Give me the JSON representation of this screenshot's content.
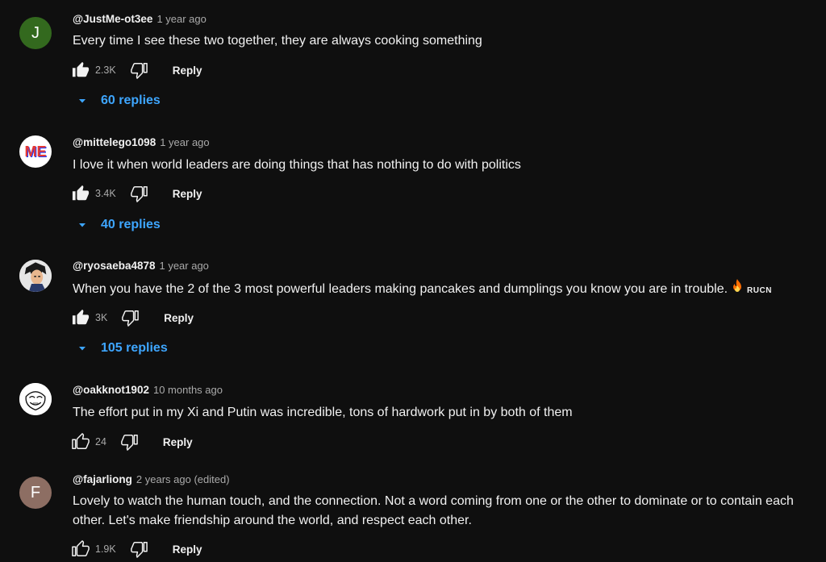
{
  "comments": [
    {
      "handle": "@JustMe-ot3ee",
      "time": "1 year ago",
      "avatar_letter": "J",
      "avatar_color": "#33691e",
      "text": "Every time I see these two together, they are always cooking something",
      "likes": "2.3K",
      "reply_label": "Reply",
      "replies_label": "60 replies"
    },
    {
      "handle": "@mittelego1098",
      "time": "1 year ago",
      "avatar_letter": "ME",
      "text": "I love it when world leaders are doing things that has nothing to do with politics",
      "likes": "3.4K",
      "reply_label": "Reply",
      "replies_label": "40 replies"
    },
    {
      "handle": "@ryosaeba4878",
      "time": "1 year ago",
      "text": "When you have the 2 of the 3 most powerful leaders making pancakes and dumplings you know you are in trouble.",
      "emoji": "fire-emoji",
      "badge": "RUCN",
      "likes": "3K",
      "reply_label": "Reply",
      "replies_label": "105 replies"
    },
    {
      "handle": "@oakknot1902",
      "time": "10 months ago",
      "text": "The effort put in my Xi and Putin was incredible, tons of hardwork put in by both of them",
      "likes": "24",
      "reply_label": "Reply"
    },
    {
      "handle": "@fajarliong",
      "time": "2 years ago (edited)",
      "avatar_letter": "F",
      "avatar_color": "#8d6e63",
      "text": "Lovely to watch the human touch, and the connection. Not a word coming from one or the other to dominate or to contain each other. Let's make friendship around the world, and respect each other.",
      "likes": "1.9K",
      "reply_label": "Reply"
    }
  ],
  "colors": {
    "background": "#0f0f0f",
    "link": "#3ea6ff",
    "muted": "#aaaaaa",
    "text": "#f1f1f1"
  },
  "icons": [
    "thumbs-up-icon",
    "thumbs-down-icon",
    "caret-down-icon",
    "fire-emoji"
  ]
}
